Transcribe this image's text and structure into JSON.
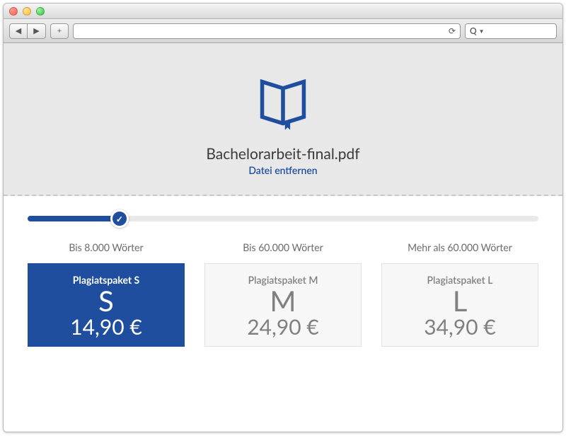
{
  "upload": {
    "filename": "Bachelorarbeit-final.pdf",
    "remove_label": "Datei entfernen"
  },
  "slider": {
    "position_pct": 18
  },
  "packages": [
    {
      "range": "Bis 8.000 Wörter",
      "name": "Plagiatspaket S",
      "size": "S",
      "price": "14,90 €",
      "active": true
    },
    {
      "range": "Bis 60.000 Wörter",
      "name": "Plagiatspaket M",
      "size": "M",
      "price": "24,90 €",
      "active": false
    },
    {
      "range": "Mehr als 60.000 Wörter",
      "name": "Plagiatspaket L",
      "size": "L",
      "price": "34,90 €",
      "active": false
    }
  ],
  "colors": {
    "brand": "#1f4e9f"
  }
}
